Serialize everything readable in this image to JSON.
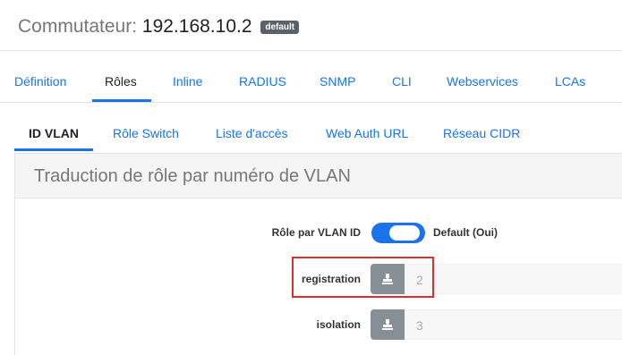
{
  "header": {
    "label": "Commutateur:",
    "ip": "192.168.10.2",
    "badge": "default"
  },
  "main_tabs": [
    {
      "label": "Définition",
      "active": false
    },
    {
      "label": "Rôles",
      "active": true
    },
    {
      "label": "Inline",
      "active": false
    },
    {
      "label": "RADIUS",
      "active": false
    },
    {
      "label": "SNMP",
      "active": false
    },
    {
      "label": "CLI",
      "active": false
    },
    {
      "label": "Webservices",
      "active": false
    },
    {
      "label": "LCAs",
      "active": false
    }
  ],
  "sub_tabs": [
    {
      "label": "ID VLAN",
      "active": true
    },
    {
      "label": "Rôle Switch",
      "active": false
    },
    {
      "label": "Liste d'accès",
      "active": false
    },
    {
      "label": "Web Auth URL",
      "active": false
    },
    {
      "label": "Réseau CIDR",
      "active": false
    }
  ],
  "panel": {
    "title": "Traduction de rôle par numéro de VLAN",
    "toggle": {
      "label": "Rôle par VLAN ID",
      "state": "on",
      "text": "Default (Oui)"
    },
    "fields": [
      {
        "label": "registration",
        "icon": "stamp-icon",
        "placeholder": "2"
      },
      {
        "label": "isolation",
        "icon": "stamp-icon",
        "placeholder": "3"
      }
    ]
  },
  "colors": {
    "accent": "#1a73e8",
    "highlight": "#d63031",
    "addon": "#868e96"
  }
}
